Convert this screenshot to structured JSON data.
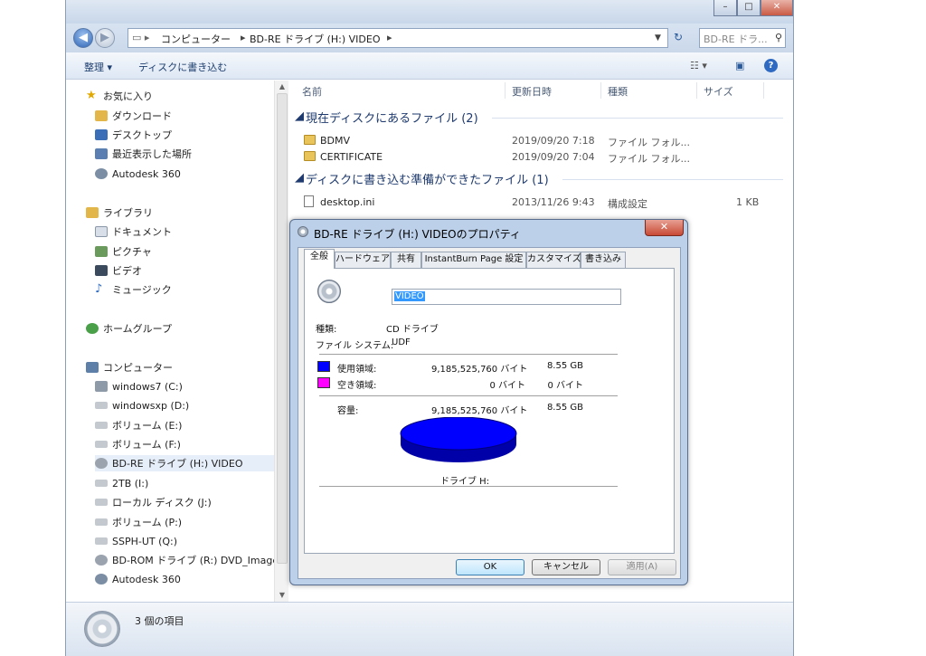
{
  "window": {
    "controls": {
      "minimize": "–",
      "maximize": "□",
      "close": "✕"
    }
  },
  "address": {
    "back": "◀",
    "forward": "▶",
    "crumbs": [
      "コンピューター",
      "BD-RE ドライブ (H:) VIDEO"
    ],
    "search_placeholder": "BD-RE ドラ..."
  },
  "toolbar": {
    "organize": "整理 ▾",
    "burn": "ディスクに書き込む"
  },
  "sidebar": {
    "favorites": {
      "label": "お気に入り",
      "items": [
        "ダウンロード",
        "デスクトップ",
        "最近表示した場所",
        "Autodesk 360"
      ]
    },
    "libraries": {
      "label": "ライブラリ",
      "items": [
        "ドキュメント",
        "ピクチャ",
        "ビデオ",
        "ミュージック"
      ]
    },
    "homegroup": "ホームグループ",
    "computer": {
      "label": "コンピューター",
      "items": [
        "windows7 (C:)",
        "windowsxp (D:)",
        "ボリューム (E:)",
        "ボリューム (F:)",
        "BD-RE ドライブ (H:) VIDEO",
        "2TB (I:)",
        "ローカル ディスク (J:)",
        "ボリューム (P:)",
        "SSPH-UT (Q:)",
        "BD-ROM ドライブ (R:) DVD_Image",
        "Autodesk 360"
      ],
      "selected_index": 4
    }
  },
  "filelist": {
    "columns": [
      "名前",
      "更新日時",
      "種類",
      "サイズ"
    ],
    "groups": [
      {
        "title": "現在ディスクにあるファイル (2)",
        "files": [
          {
            "name": "BDMV",
            "date": "2019/09/20 7:18",
            "type": "ファイル フォル...",
            "size": ""
          },
          {
            "name": "CERTIFICATE",
            "date": "2019/09/20 7:04",
            "type": "ファイル フォル...",
            "size": ""
          }
        ]
      },
      {
        "title": "ディスクに書き込む準備ができたファイル (1)",
        "files": [
          {
            "name": "desktop.ini",
            "date": "2013/11/26 9:43",
            "type": "構成設定",
            "size": "1 KB"
          }
        ]
      }
    ]
  },
  "status": {
    "item_count": "3 個の項目"
  },
  "dialog": {
    "title": "BD-RE ドライブ (H:) VIDEOのプロパティ",
    "close": "✕",
    "tabs": [
      "全般",
      "ハードウェア",
      "共有",
      "InstantBurn Page 設定",
      "カスタマイズ",
      "書き込み"
    ],
    "active_tab": 0,
    "volume_name": "VIDEO",
    "type_label": "種類:",
    "type_value": "CD ドライブ",
    "fs_label": "ファイル システム:",
    "fs_value": "UDF",
    "used_label": "使用領域:",
    "used_bytes": "9,185,525,760 バイト",
    "used_gb": "8.55 GB",
    "free_label": "空き領域:",
    "free_bytes": "0 バイト",
    "free_gb": "0 バイト",
    "capacity_label": "容量:",
    "capacity_bytes": "9,185,525,760 バイト",
    "capacity_gb": "8.55 GB",
    "drive_label": "ドライブ H:",
    "used_fraction": 1.0,
    "colors": {
      "used": "#0000ff",
      "free": "#ff00ff"
    },
    "buttons": {
      "ok": "OK",
      "cancel": "キャンセル",
      "apply": "適用(A)"
    }
  }
}
